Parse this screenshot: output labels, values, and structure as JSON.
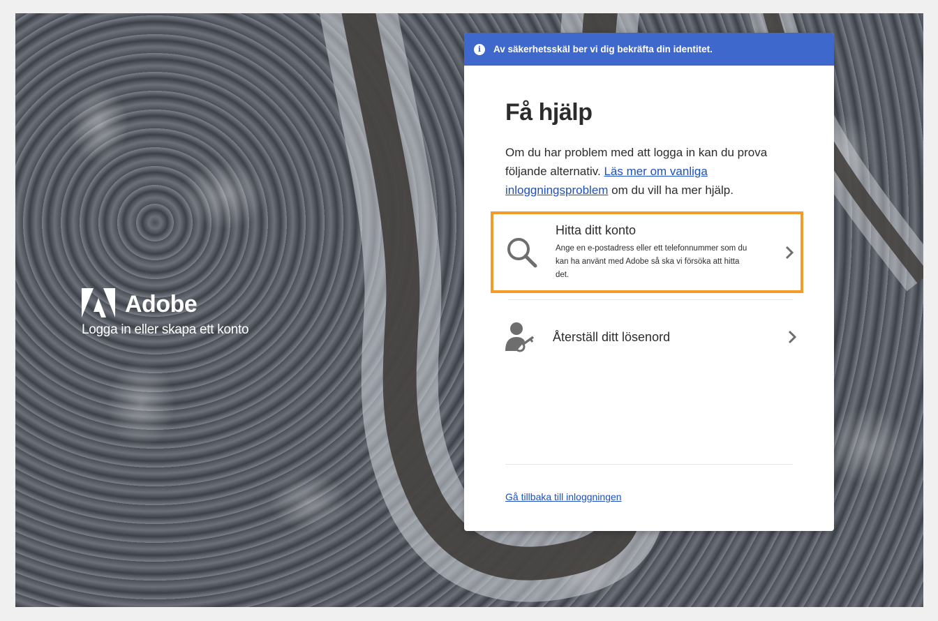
{
  "brand": {
    "name": "Adobe",
    "tagline": "Logga in eller skapa ett konto"
  },
  "banner": {
    "text": "Av säkerhetsskäl ber vi dig bekräfta din identitet."
  },
  "card": {
    "title": "Få hjälp",
    "description_before": "Om du har problem med att logga in kan du prova följande alternativ. ",
    "description_link": "Läs mer om vanliga inloggningsproblem",
    "description_after": " om du vill ha mer hjälp."
  },
  "options": {
    "find_account": {
      "title": "Hitta ditt konto",
      "subtitle": "Ange en e-postadress eller ett telefonnummer som du kan ha använt med Adobe så ska vi försöka att hitta det."
    },
    "reset_password": {
      "title": "Återställ ditt lösenord"
    }
  },
  "footer": {
    "back_link": "Gå tillbaka till inloggningen"
  },
  "colors": {
    "banner": "#3e68cc",
    "highlight": "#f39c2c",
    "link": "#1c4fc2"
  }
}
